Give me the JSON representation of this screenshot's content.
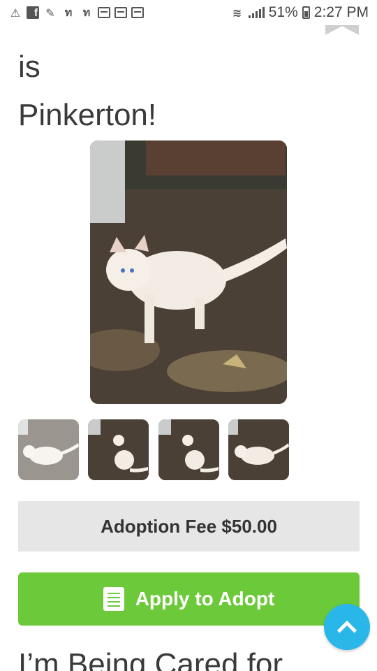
{
  "status_bar": {
    "notifications": [
      "warning-icon",
      "facebook-icon",
      "feather-icon",
      "n-icon",
      "n-icon",
      "image-icon",
      "news-icon",
      "news-icon"
    ],
    "battery": "51%",
    "time": "2:27 PM"
  },
  "page": {
    "title_line_is": "is",
    "title_name": "Pinkerton!",
    "adoption_fee": "Adoption Fee $50.00",
    "apply_label": "Apply to Adopt",
    "section_heading": "I’m Being Cared for"
  },
  "colors": {
    "apply_green": "#6cc93a",
    "fee_bg": "#e6e6e6",
    "scroll_top_blue": "#29b6e8"
  }
}
